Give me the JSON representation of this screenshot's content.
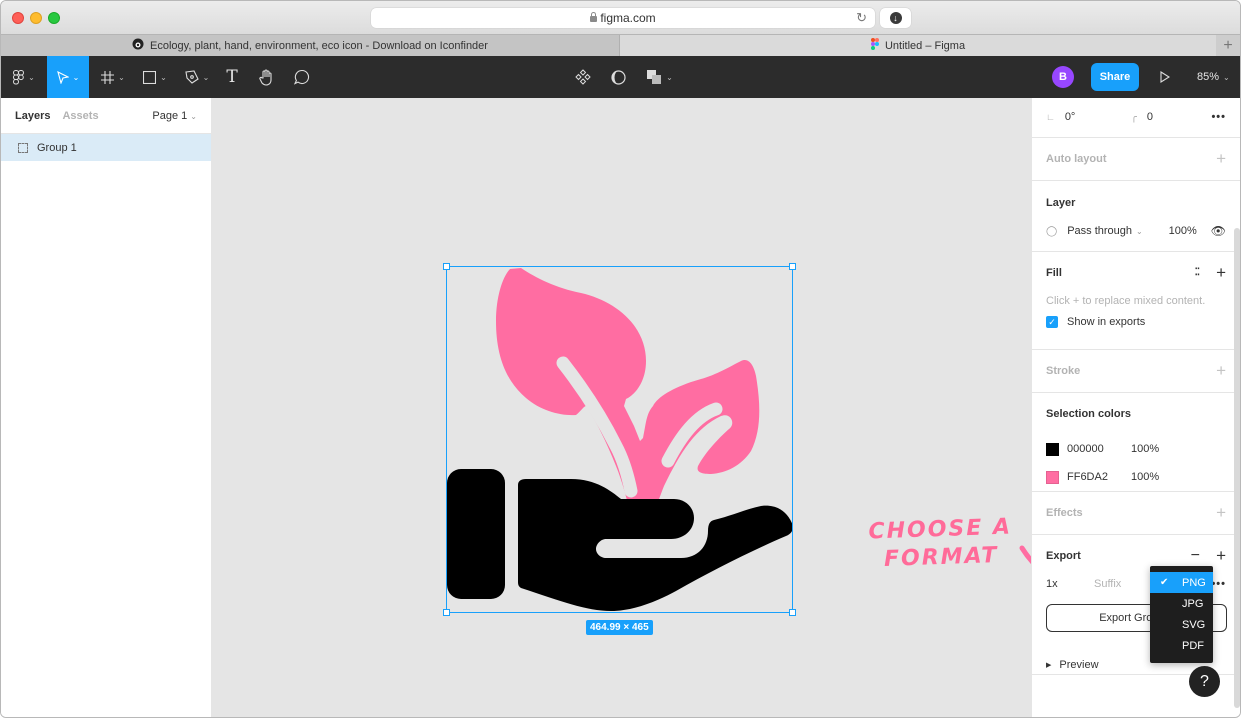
{
  "browser": {
    "url": "figma.com",
    "tabs": [
      {
        "label": "Ecology, plant, hand, environment, eco icon - Download on Iconfinder",
        "active": false
      },
      {
        "label": "Untitled – Figma",
        "active": true
      }
    ],
    "new_tab_label": "+"
  },
  "toolbar": {
    "tools": [
      {
        "name": "main-menu",
        "icon": "figma-logo-icon"
      },
      {
        "name": "move",
        "icon": "move-arrow-icon",
        "active": true
      },
      {
        "name": "frame",
        "icon": "frame-icon"
      },
      {
        "name": "shape",
        "icon": "rectangle-icon"
      },
      {
        "name": "pen",
        "icon": "pen-icon"
      },
      {
        "name": "text",
        "icon": "text-icon",
        "glyph": "T"
      },
      {
        "name": "hand",
        "icon": "hand-icon"
      },
      {
        "name": "comment",
        "icon": "comment-icon"
      }
    ],
    "center_tools": [
      "component-icon",
      "mask-icon",
      "boolean-icon"
    ],
    "avatar_initial": "B",
    "share_label": "Share",
    "zoom": "85%"
  },
  "left_panel": {
    "tabs": [
      "Layers",
      "Assets"
    ],
    "active_tab": "Layers",
    "page": "Page 1",
    "layers": [
      {
        "name": "Group 1",
        "selected": true
      }
    ]
  },
  "canvas": {
    "selection_size": "464.99 × 465",
    "annotation": [
      "CHOOSE A",
      "FORMAT"
    ],
    "colors": {
      "leaf": "#FF6DA2",
      "hand": "#000000",
      "accent": "#18A0FB"
    }
  },
  "right_panel": {
    "rotation": "0°",
    "corner_radius": "0",
    "auto_layout": {
      "title": "Auto layout"
    },
    "layer": {
      "title": "Layer",
      "blend_mode": "Pass through",
      "opacity": "100%"
    },
    "fill": {
      "title": "Fill",
      "mixed_message": "Click + to replace mixed content.",
      "show_in_exports": "Show in exports"
    },
    "stroke": {
      "title": "Stroke"
    },
    "selection_colors": {
      "title": "Selection colors",
      "items": [
        {
          "hex": "000000",
          "opacity": "100%",
          "swatch": "#000000"
        },
        {
          "hex": "FF6DA2",
          "opacity": "100%",
          "swatch": "#FF6DA2"
        }
      ]
    },
    "effects": {
      "title": "Effects"
    },
    "export": {
      "title": "Export",
      "scale": "1x",
      "suffix_placeholder": "Suffix",
      "button_label": "Export Group 1",
      "preview_label": "Preview",
      "format_options": [
        "PNG",
        "JPG",
        "SVG",
        "PDF"
      ],
      "selected_format": "PNG"
    }
  },
  "help_label": "?"
}
